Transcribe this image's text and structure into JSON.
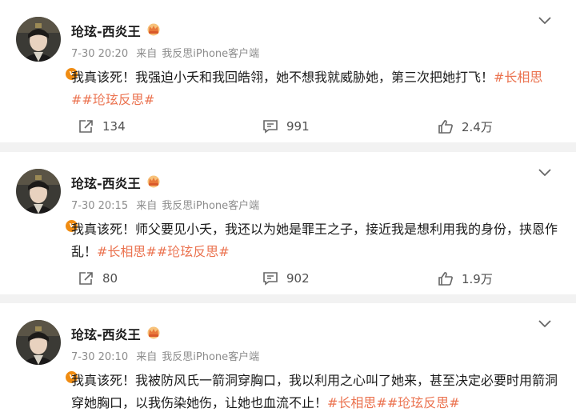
{
  "posts": [
    {
      "author": "玱玹-西炎王",
      "time": "7-30 20:20",
      "source_prefix": "来自",
      "source": "我反思iPhone客户端",
      "text": "我真该死！我强迫小夭和我回皓翎，她不想我就威胁她，第三次把她打飞！",
      "tags": [
        "#长相思#",
        "#玱玹反思#"
      ],
      "reposts": "134",
      "comments": "991",
      "likes": "2.4万"
    },
    {
      "author": "玱玹-西炎王",
      "time": "7-30 20:15",
      "source_prefix": "来自",
      "source": "我反思iPhone客户端",
      "text": "我真该死！师父要见小夭，我还以为她是罪王之子，接近我是想利用我的身份，挟恩作乱！",
      "tags": [
        "#长相思#",
        "#玱玹反思#"
      ],
      "reposts": "80",
      "comments": "902",
      "likes": "1.9万"
    },
    {
      "author": "玱玹-西炎王",
      "time": "7-30 20:10",
      "source_prefix": "来自",
      "source": "我反思iPhone客户端",
      "text": "我真该死！我被防风氏一箭洞穿胸口，我以利用之心叫了她来，甚至决定必要时用箭洞穿她胸口，以我伤染她伤，让她也血流不止！",
      "tags": [
        "#长相思#",
        "#玱玹反思#"
      ]
    }
  ],
  "icons": {
    "more": "chevron-down-icon",
    "share": "repost-icon",
    "comment": "comment-icon",
    "like": "thumbs-up-icon",
    "verified": "verified-badge-icon",
    "crown": "crown-badge-icon"
  },
  "colors": {
    "tag": "#eb7350",
    "badge": "#f08c12",
    "meta": "#8c8c8c"
  },
  "badge_text": "v"
}
